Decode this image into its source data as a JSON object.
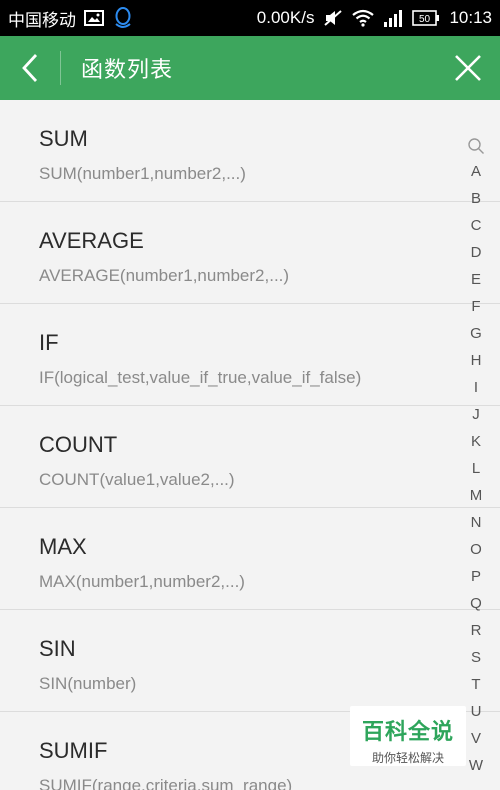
{
  "status_bar": {
    "carrier": "中国移动",
    "speed": "0.00K/s",
    "battery": "50",
    "time": "10:13"
  },
  "header": {
    "title": "函数列表"
  },
  "functions": [
    {
      "name": "SUM",
      "syntax": "SUM(number1,number2,...)"
    },
    {
      "name": "AVERAGE",
      "syntax": "AVERAGE(number1,number2,...)"
    },
    {
      "name": "IF",
      "syntax": "IF(logical_test,value_if_true,value_if_false)"
    },
    {
      "name": "COUNT",
      "syntax": "COUNT(value1,value2,...)"
    },
    {
      "name": "MAX",
      "syntax": "MAX(number1,number2,...)"
    },
    {
      "name": "SIN",
      "syntax": "SIN(number)"
    },
    {
      "name": "SUMIF",
      "syntax": "SUMIF(range,criteria,sum_range)"
    }
  ],
  "alphabet": [
    "A",
    "B",
    "C",
    "D",
    "E",
    "F",
    "G",
    "H",
    "I",
    "J",
    "K",
    "L",
    "M",
    "N",
    "O",
    "P",
    "Q",
    "R",
    "S",
    "T",
    "U",
    "V",
    "W"
  ],
  "watermark": {
    "main": "百科全说",
    "sub": "助你轻松解决"
  },
  "colors": {
    "header_bg": "#3da65d",
    "watermark_green": "#2ea55b"
  }
}
